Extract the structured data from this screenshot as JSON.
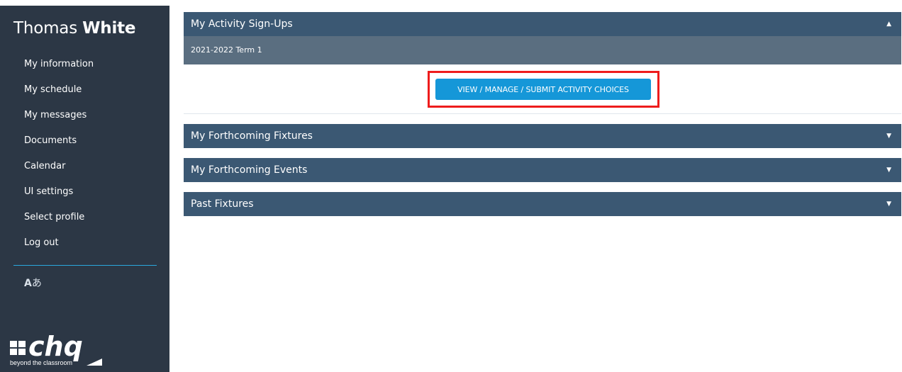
{
  "user": {
    "first_name": "Thomas",
    "last_name": "White"
  },
  "sidebar": {
    "items": [
      {
        "label": "My information"
      },
      {
        "label": "My schedule"
      },
      {
        "label": "My messages"
      },
      {
        "label": "Documents"
      },
      {
        "label": "Calendar"
      },
      {
        "label": "UI settings"
      },
      {
        "label": "Select profile"
      },
      {
        "label": "Log out"
      }
    ],
    "language": {
      "latin": "A",
      "japanese": "あ"
    },
    "logo": {
      "brand": "chq",
      "tagline": "beyond the classroom"
    }
  },
  "main": {
    "panels": [
      {
        "title": "My Activity Sign-Ups",
        "caret": "▲",
        "expanded": true
      },
      {
        "title": "My Forthcoming Fixtures",
        "caret": "▼",
        "expanded": false
      },
      {
        "title": "My Forthcoming Events",
        "caret": "▼",
        "expanded": false
      },
      {
        "title": "Past Fixtures",
        "caret": "▼",
        "expanded": false
      }
    ],
    "signups": {
      "term": "2021-2022 Term 1",
      "button_label": "VIEW / MANAGE / SUBMIT ACTIVITY CHOICES"
    }
  },
  "colors": {
    "sidebar_bg": "#2c3745",
    "panel_header": "#3b5873",
    "term_bar": "#5a6e80",
    "button": "#1597d8",
    "highlight": "#ee1c1c",
    "divider": "#2aa9de"
  }
}
